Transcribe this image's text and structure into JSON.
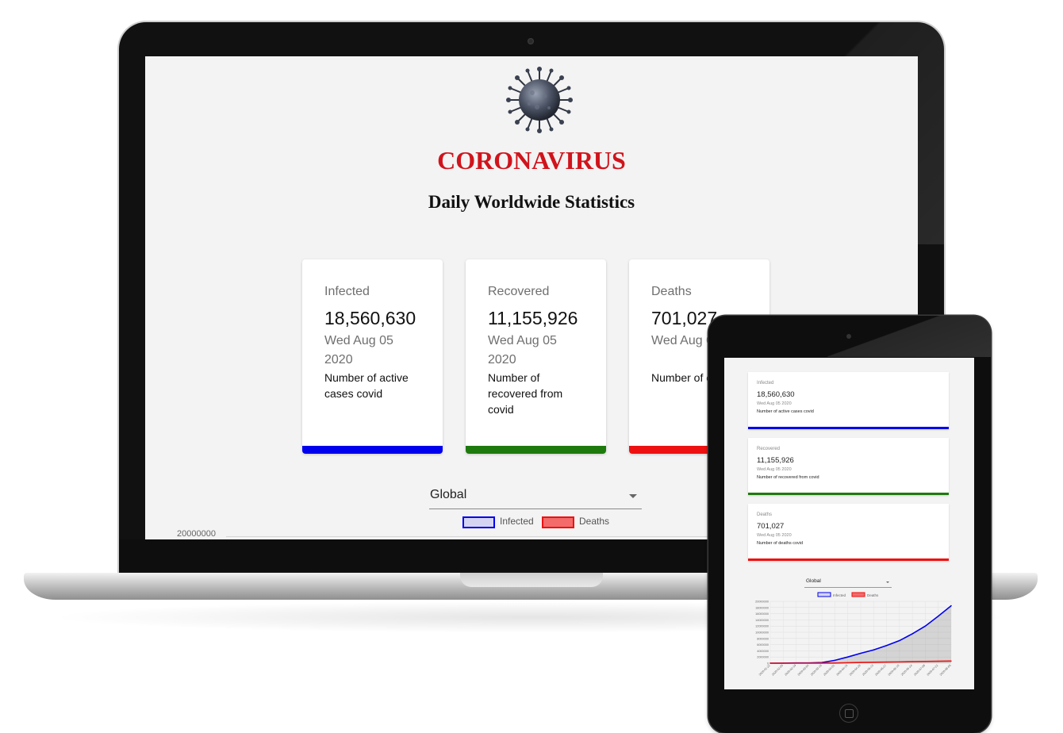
{
  "laptop": {
    "title": "CORONAVIRUS",
    "subtitle": "Daily Worldwide Statistics",
    "cards": [
      {
        "label": "Infected",
        "value": "18,560,630",
        "date": "Wed Aug 05 2020",
        "description": "Number of active cases covid",
        "color": "#0000ee"
      },
      {
        "label": "Recovered",
        "value": "11,155,926",
        "date": "Wed Aug 05 2020",
        "description": "Number of recovered from covid",
        "color": "#1f7a0e"
      },
      {
        "label": "Deaths",
        "value": "701,027",
        "date": "Wed Aug 0",
        "description": "Number of d covid",
        "color": "#ee1111"
      }
    ],
    "country_select": {
      "value": "Global"
    },
    "legend": [
      {
        "name": "Infected",
        "color": "#0000ee"
      },
      {
        "name": "Deaths",
        "color": "#ee1111"
      }
    ],
    "y_tick_top": "20000000"
  },
  "tablet": {
    "cards": [
      {
        "label": "Infected",
        "value": "18,560,630",
        "date": "Wed Aug 05 2020",
        "description": "Number of active cases covid",
        "color": "#0000ee"
      },
      {
        "label": "Recovered",
        "value": "11,155,926",
        "date": "Wed Aug 05 2020",
        "description": "Number of recovered from covid",
        "color": "#1f7a0e"
      },
      {
        "label": "Deaths",
        "value": "701,027",
        "date": "Wed Aug 05 2020",
        "description": "Number of deaths covid",
        "color": "#ee1111"
      }
    ],
    "country_select": {
      "value": "Global"
    },
    "legend": [
      {
        "name": "Infected",
        "color": "#0000ee"
      },
      {
        "name": "Deaths",
        "color": "#ee1111"
      }
    ]
  },
  "chart_data": {
    "type": "line",
    "title": "",
    "xlabel": "",
    "ylabel": "",
    "ylim": [
      0,
      20000000
    ],
    "y_ticks": [
      0,
      2000000,
      4000000,
      6000000,
      8000000,
      10000000,
      12000000,
      14000000,
      16000000,
      18000000,
      20000000
    ],
    "x": [
      "2020-01-22",
      "2020-02-05",
      "2020-02-19",
      "2020-03-04",
      "2020-03-18",
      "2020-04-01",
      "2020-04-15",
      "2020-04-29",
      "2020-05-13",
      "2020-05-27",
      "2020-06-10",
      "2020-06-24",
      "2020-07-08",
      "2020-07-22",
      "2020-08-05"
    ],
    "series": [
      {
        "name": "Infected",
        "values": [
          600,
          24000,
          75000,
          95000,
          220000,
          930000,
          2000000,
          3200000,
          4300000,
          5700000,
          7300000,
          9500000,
          12000000,
          15200000,
          18560630
        ]
      },
      {
        "name": "Deaths",
        "values": [
          17,
          490,
          2100,
          3200,
          9000,
          51000,
          135000,
          230000,
          295000,
          360000,
          415000,
          490000,
          555000,
          630000,
          701027
        ]
      }
    ],
    "grid": true,
    "legend_position": "top"
  }
}
